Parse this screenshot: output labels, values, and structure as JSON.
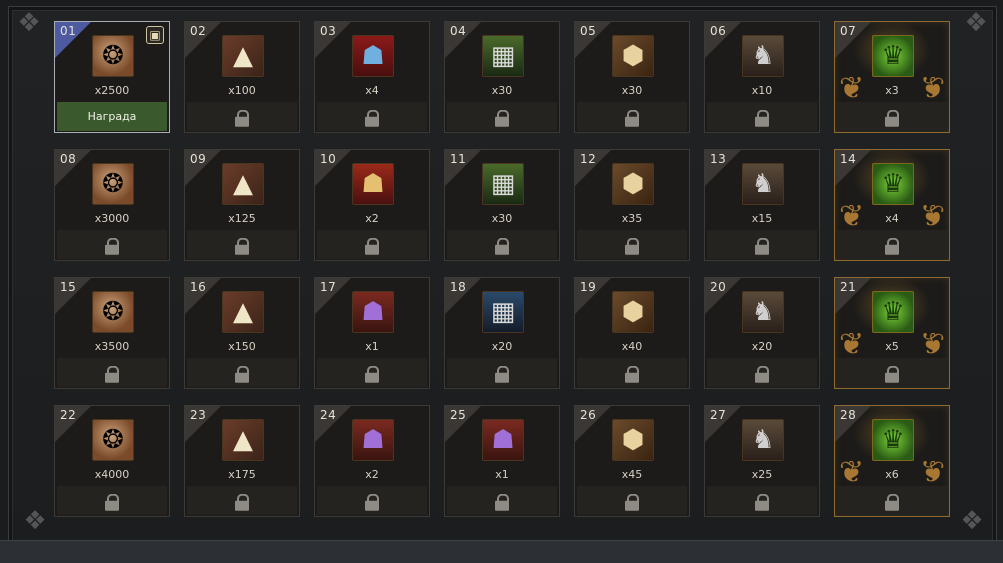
{
  "claim_label": "Награда",
  "accent_colors": {
    "claim_button": "#3a5a2e",
    "special_border": "#8d6a34",
    "lock": "#8e8a84"
  },
  "cells": [
    {
      "num": "01",
      "qty": "x2500",
      "item": "coin-icon",
      "state": "claimable",
      "gift_icon": "gift-icon"
    },
    {
      "num": "02",
      "qty": "x100",
      "item": "powder-pile-icon",
      "state": "locked"
    },
    {
      "num": "03",
      "qty": "x4",
      "item": "card-blue-icon",
      "state": "locked"
    },
    {
      "num": "04",
      "qty": "x30",
      "item": "book-green-icon",
      "state": "locked"
    },
    {
      "num": "05",
      "qty": "x30",
      "item": "ore-icon",
      "state": "locked"
    },
    {
      "num": "06",
      "qty": "x10",
      "item": "statue-icon",
      "state": "locked"
    },
    {
      "num": "07",
      "qty": "x3",
      "item": "chest-icon",
      "state": "locked",
      "special": true
    },
    {
      "num": "08",
      "qty": "x3000",
      "item": "coin-icon",
      "state": "locked"
    },
    {
      "num": "09",
      "qty": "x125",
      "item": "powder-pile-icon",
      "state": "locked"
    },
    {
      "num": "10",
      "qty": "x2",
      "item": "card-red-icon",
      "state": "locked"
    },
    {
      "num": "11",
      "qty": "x30",
      "item": "book-green-icon",
      "state": "locked"
    },
    {
      "num": "12",
      "qty": "x35",
      "item": "ore-icon",
      "state": "locked"
    },
    {
      "num": "13",
      "qty": "x15",
      "item": "statue-icon",
      "state": "locked"
    },
    {
      "num": "14",
      "qty": "x4",
      "item": "chest-icon",
      "state": "locked",
      "special": true
    },
    {
      "num": "15",
      "qty": "x3500",
      "item": "coin-icon",
      "state": "locked"
    },
    {
      "num": "16",
      "qty": "x150",
      "item": "powder-pile-icon",
      "state": "locked"
    },
    {
      "num": "17",
      "qty": "x1",
      "item": "card-purple-icon",
      "state": "locked"
    },
    {
      "num": "18",
      "qty": "x20",
      "item": "book-blue-icon",
      "state": "locked"
    },
    {
      "num": "19",
      "qty": "x40",
      "item": "ore-icon",
      "state": "locked"
    },
    {
      "num": "20",
      "qty": "x20",
      "item": "statue-icon",
      "state": "locked"
    },
    {
      "num": "21",
      "qty": "x5",
      "item": "chest-icon",
      "state": "locked",
      "special": true
    },
    {
      "num": "22",
      "qty": "x4000",
      "item": "coin-icon",
      "state": "locked"
    },
    {
      "num": "23",
      "qty": "x175",
      "item": "powder-pile-icon",
      "state": "locked"
    },
    {
      "num": "24",
      "qty": "x2",
      "item": "card-purple-icon",
      "state": "locked"
    },
    {
      "num": "25",
      "qty": "x1",
      "item": "card-purple-icon",
      "state": "locked"
    },
    {
      "num": "26",
      "qty": "x45",
      "item": "ore-icon",
      "state": "locked"
    },
    {
      "num": "27",
      "qty": "x25",
      "item": "statue-icon",
      "state": "locked"
    },
    {
      "num": "28",
      "qty": "x6",
      "item": "chest-icon",
      "state": "locked",
      "special": true
    }
  ]
}
